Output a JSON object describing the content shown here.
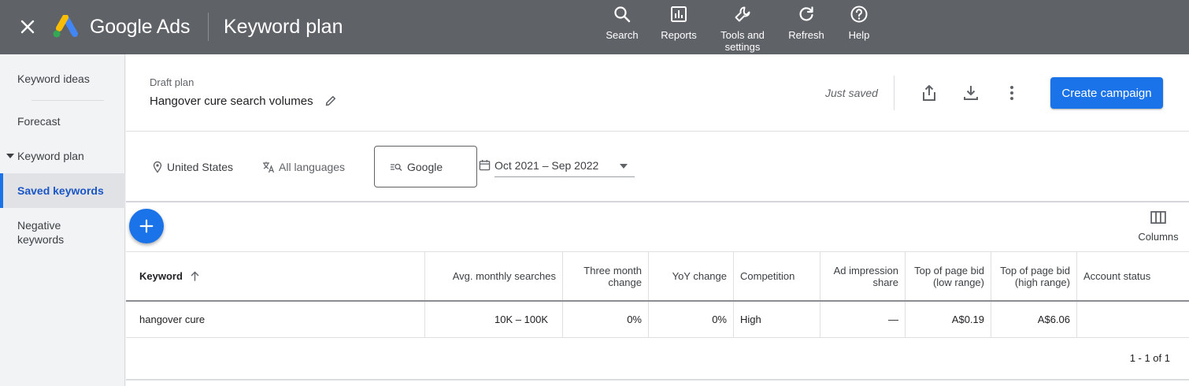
{
  "topbar": {
    "brand": "Google Ads",
    "title": "Keyword plan",
    "actions": [
      {
        "label": "Search",
        "icon": "search-icon"
      },
      {
        "label": "Reports",
        "icon": "reports-icon"
      },
      {
        "label": "Tools and settings",
        "icon": "wrench-icon"
      },
      {
        "label": "Refresh",
        "icon": "refresh-icon"
      },
      {
        "label": "Help",
        "icon": "help-icon"
      }
    ]
  },
  "sidebar": {
    "items": [
      {
        "label": "Keyword ideas"
      },
      {
        "label": "Forecast"
      },
      {
        "label": "Keyword plan"
      },
      {
        "label": "Saved keywords"
      },
      {
        "label": "Negative keywords"
      }
    ]
  },
  "plan": {
    "status_label": "Draft plan",
    "name": "Hangover cure search volumes",
    "saved_status": "Just saved",
    "create_label": "Create campaign"
  },
  "filters": {
    "location": "United States",
    "language": "All languages",
    "network": "Google",
    "date_range": "Oct 2021 – Sep 2022"
  },
  "toolbar": {
    "columns_label": "Columns"
  },
  "table": {
    "headers": {
      "keyword": "Keyword",
      "avg_monthly": "Avg. monthly searches",
      "three_month": "Three month change",
      "yoy": "YoY change",
      "competition": "Competition",
      "ad_impression": "Ad impression share",
      "bid_low": "Top of page bid (low range)",
      "bid_high": "Top of page bid (high range)",
      "account_status": "Account status"
    },
    "rows": [
      {
        "keyword": "hangover cure",
        "avg_monthly": "10K – 100K",
        "three_month": "0%",
        "yoy": "0%",
        "competition": "High",
        "ad_impression": "—",
        "bid_low": "A$0.19",
        "bid_high": "A$6.06",
        "account_status": ""
      }
    ],
    "pagination": "1 - 1 of 1"
  },
  "colors": {
    "topbar": "#5f6368",
    "accent": "#1a73e8",
    "active_nav": "#1a56c6"
  }
}
